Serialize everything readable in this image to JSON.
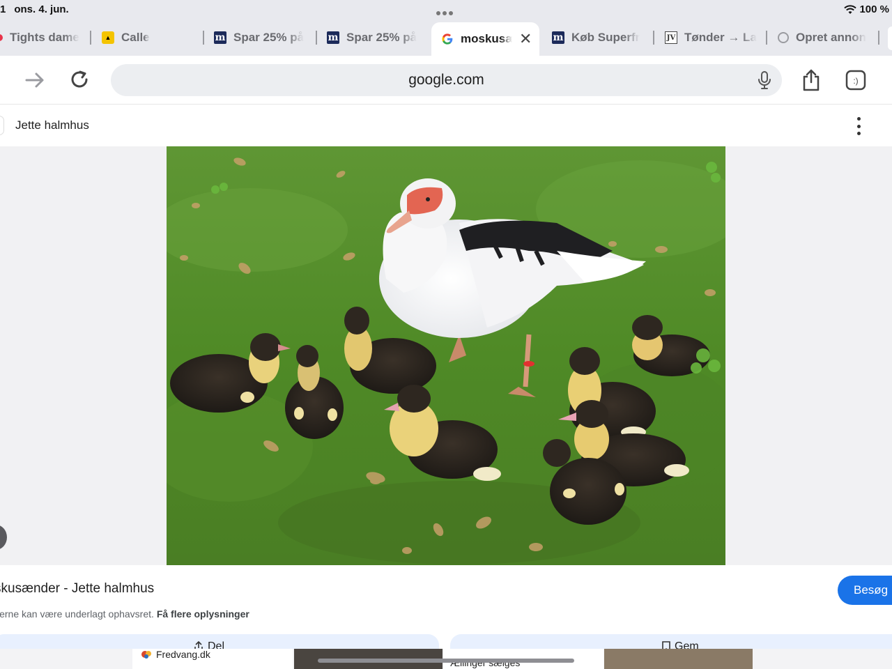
{
  "status_bar": {
    "time_fragment": "1",
    "date": "ons. 4. jun.",
    "battery": "100 %"
  },
  "tabs": [
    {
      "label": "Tights dame",
      "favicon": "red-dot-icon"
    },
    {
      "label": "Calle",
      "favicon": "calle-logo-icon"
    },
    {
      "label": "Spar 25% på",
      "favicon": "m-logo-icon"
    },
    {
      "label": "Spar 25% på",
      "favicon": "m-logo-icon"
    },
    {
      "label": "moskusænder",
      "favicon": "google-g-icon",
      "active": true
    },
    {
      "label": "Køb Superfr",
      "favicon": "m-logo-icon"
    },
    {
      "label": "Tønder → La",
      "favicon": "jv-logo-icon"
    },
    {
      "label": "Opret annon",
      "favicon": "generic-site-icon"
    }
  ],
  "toolbar": {
    "url": "google.com"
  },
  "result": {
    "source_name": "Jette halmhus",
    "title": "skusænder - Jette halmhus",
    "visit_label": "Besøg",
    "copyright_text": "lerne kan være underlagt ophavsret.",
    "copyright_link": "Få flere oplysninger",
    "share_label": "Del",
    "save_label": "Gem"
  },
  "strip": {
    "source1": "Fredvang.dk",
    "caption2": "Ællinger sælges"
  },
  "colors": {
    "accent": "#1a73e8",
    "chrome": "#e8e9ee",
    "grass": "#5b8c2e"
  }
}
